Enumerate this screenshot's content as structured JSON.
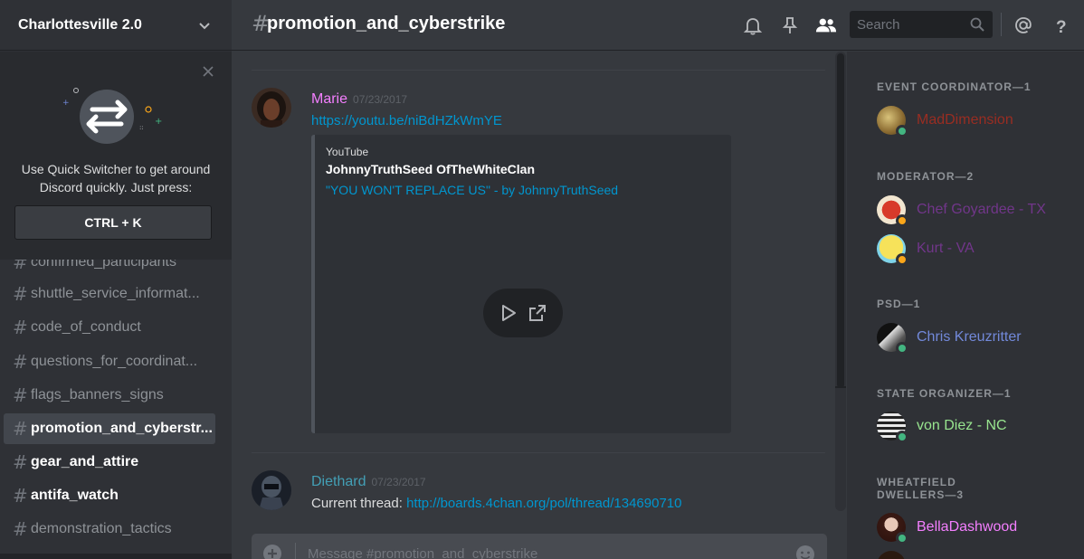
{
  "guild": {
    "name": "Charlottesville 2.0"
  },
  "quick_switcher": {
    "text": "Use Quick Switcher to get around Discord quickly. Just press:",
    "shortcut": "CTRL + K"
  },
  "channels": [
    {
      "name": "confirmed_participants",
      "state": "partial"
    },
    {
      "name": "shuttle_service_informat...",
      "state": "normal"
    },
    {
      "name": "code_of_conduct",
      "state": "normal"
    },
    {
      "name": "questions_for_coordinat...",
      "state": "normal"
    },
    {
      "name": "flags_banners_signs",
      "state": "normal"
    },
    {
      "name": "promotion_and_cyberstr...",
      "state": "active"
    },
    {
      "name": "gear_and_attire",
      "state": "unread"
    },
    {
      "name": "antifa_watch",
      "state": "unread"
    },
    {
      "name": "demonstration_tactics",
      "state": "normal"
    }
  ],
  "header": {
    "hash": "#",
    "channel_title": "promotion_and_cyberstrike",
    "search_placeholder": "Search"
  },
  "messages": [
    {
      "author": "Marie",
      "author_color": "#f47fff",
      "timestamp": "07/23/2017",
      "link": "https://youtu.be/niBdHZkWmYE",
      "embed": {
        "provider": "YouTube",
        "author": "JohnnyTruthSeed OfTheWhiteClan",
        "title": "\"YOU WON'T REPLACE US\" - by JohnnyTruthSeed"
      }
    },
    {
      "author": "Diethard",
      "author_color": "#439fb5",
      "timestamp": "07/23/2017",
      "text": "Current thread: ",
      "link": "http://boards.4chan.org/pol/thread/134690710"
    }
  ],
  "composer": {
    "placeholder": "Message #promotion_and_cyberstrike"
  },
  "members": {
    "roles": [
      {
        "label": "EVENT COORDINATOR—1",
        "members": [
          {
            "name": "MadDimension",
            "color": "#992d22",
            "status": "#43b581"
          }
        ]
      },
      {
        "label": "MODERATOR—2",
        "members": [
          {
            "name": "Chef Goyardee - TX",
            "color": "#71368a",
            "status": "#faa61a"
          },
          {
            "name": "Kurt - VA",
            "color": "#71368a",
            "status": "#faa61a"
          }
        ]
      },
      {
        "label": "PSD—1",
        "members": [
          {
            "name": "Chris Kreuzritter",
            "color": "#7289da",
            "status": "#43b581"
          }
        ]
      },
      {
        "label": "STATE ORGANIZER—1",
        "members": [
          {
            "name": "von Diez - NC",
            "color": "#98e58f",
            "status": "#43b581"
          }
        ]
      },
      {
        "label": "WHEATFIELD DWELLERS—3",
        "members": [
          {
            "name": "BellaDashwood",
            "color": "#f47fff",
            "status": "#43b581"
          }
        ]
      }
    ]
  }
}
